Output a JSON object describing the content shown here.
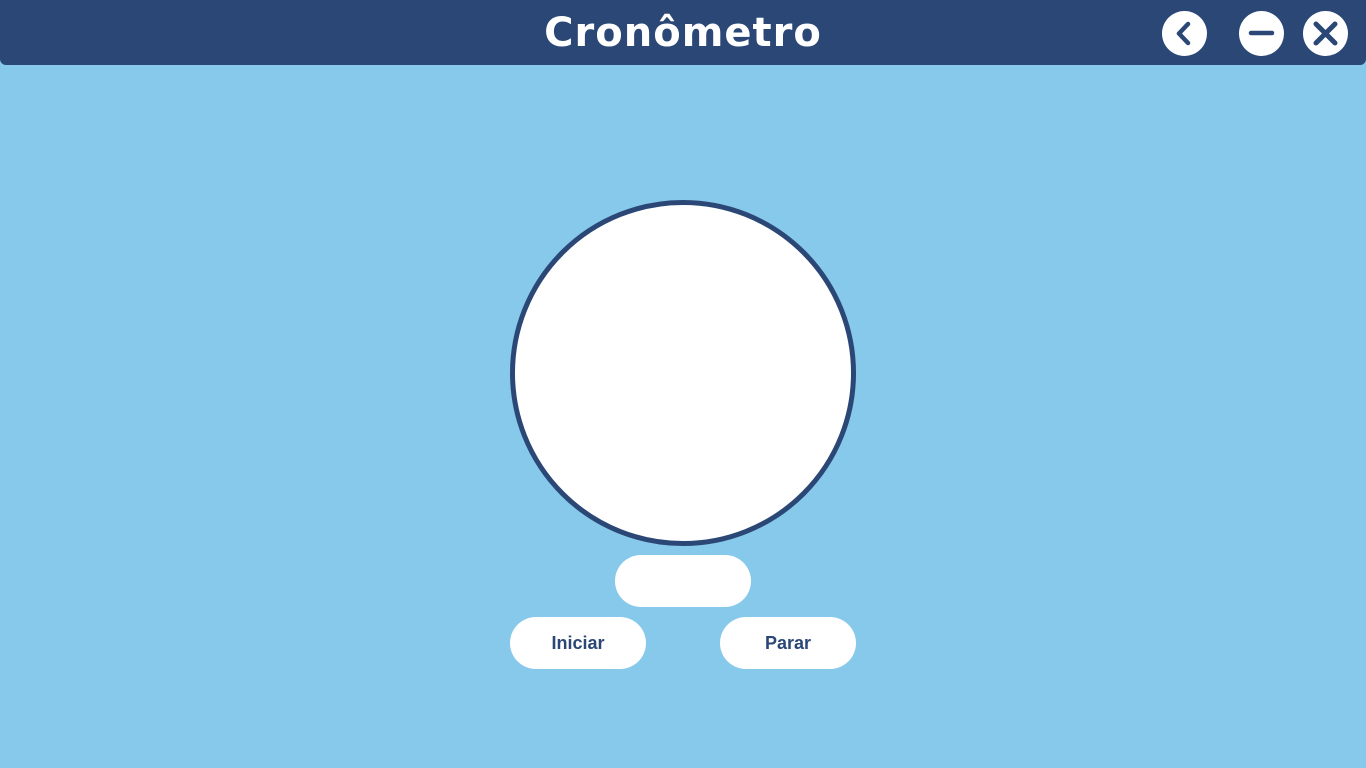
{
  "window": {
    "title": "Cronômetro",
    "controls": [
      {
        "name": "back",
        "icon": "chevron-left-icon"
      },
      {
        "name": "minimize",
        "icon": "minus-icon"
      },
      {
        "name": "close",
        "icon": "close-icon"
      }
    ]
  },
  "stopwatch": {
    "time_display": "",
    "start_label": "Iniciar",
    "stop_label": "Parar"
  },
  "colors": {
    "background": "#87c9eb",
    "primary": "#2b4776",
    "surface": "#ffffff"
  }
}
